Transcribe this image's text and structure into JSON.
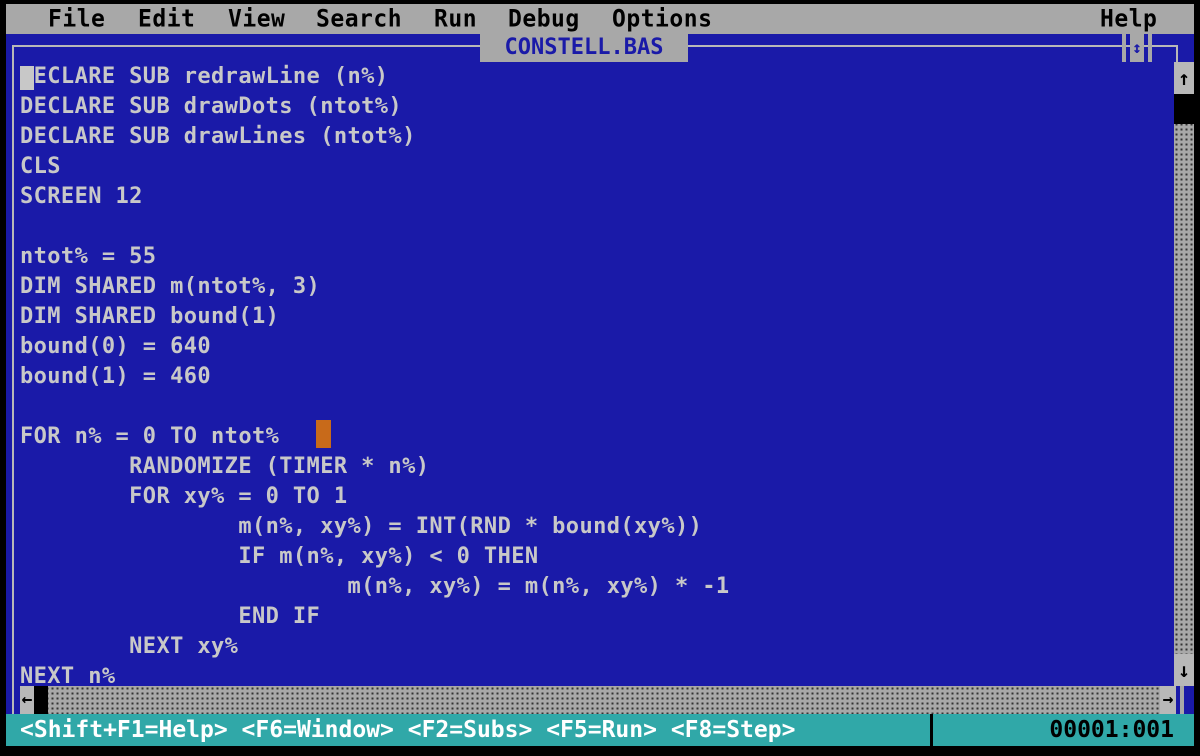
{
  "menubar": {
    "items": [
      {
        "label": "File"
      },
      {
        "label": "Edit"
      },
      {
        "label": "View"
      },
      {
        "label": "Search"
      },
      {
        "label": "Run"
      },
      {
        "label": "Debug"
      },
      {
        "label": "Options"
      },
      {
        "label": "Help"
      }
    ]
  },
  "window": {
    "title": "CONSTELL.BAS",
    "maximize_icon": "updown-arrow-icon"
  },
  "editor": {
    "lines": [
      "DECLARE SUB redrawLine (n%)",
      "DECLARE SUB drawDots (ntot%)",
      "DECLARE SUB drawLines (ntot%)",
      "CLS",
      "SCREEN 12",
      "",
      "ntot% = 55",
      "DIM SHARED m(ntot%, 3)",
      "DIM SHARED bound(1)",
      "bound(0) = 640",
      "bound(1) = 460",
      "",
      "FOR n% = 0 TO ntot%",
      "        RANDOMIZE (TIMER * n%)",
      "        FOR xy% = 0 TO 1",
      "                m(n%, xy%) = INT(RND * bound(xy%))",
      "                IF m(n%, xy%) < 0 THEN",
      "                        m(n%, xy%) = m(n%, xy%) * -1",
      "                END IF",
      "        NEXT xy%",
      "NEXT n%"
    ]
  },
  "scrollbars": {
    "vertical": {
      "up_icon": "↑",
      "down_icon": "↓"
    },
    "horizontal": {
      "left_icon": "←",
      "right_icon": "→"
    }
  },
  "statusbar": {
    "hints": "<Shift+F1=Help> <F6=Window> <F2=Subs> <F5=Run> <F8=Step>",
    "position": "00001:001"
  },
  "colors": {
    "editor_bg": "#1a1aa8",
    "menubar_bg": "#a8a8a8",
    "statusbar_bg": "#30a8a8",
    "code_text": "#c8c8c8",
    "highlight_cursor": "#c86a1a"
  }
}
